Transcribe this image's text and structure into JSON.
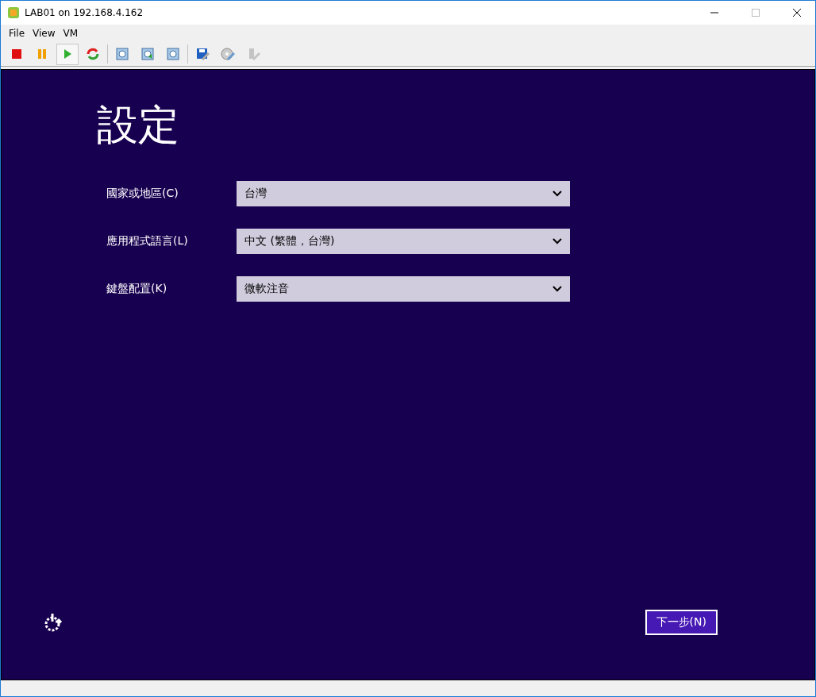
{
  "window": {
    "title": "LAB01 on 192.168.4.162"
  },
  "menu": [
    "File",
    "View",
    "VM"
  ],
  "toolbar": [
    {
      "kind": "stop",
      "selected": false,
      "disabled": false
    },
    {
      "kind": "pause",
      "selected": false,
      "disabled": false
    },
    {
      "kind": "start",
      "selected": true,
      "disabled": false
    },
    {
      "kind": "reset",
      "selected": false,
      "disabled": false
    },
    {
      "kind": "snapshot",
      "selected": false,
      "disabled": false
    },
    {
      "kind": "revert",
      "selected": false,
      "disabled": false
    },
    {
      "kind": "manage",
      "selected": false,
      "disabled": false
    },
    {
      "kind": "floppy",
      "selected": false,
      "disabled": false
    },
    {
      "kind": "cd",
      "selected": false,
      "disabled": false
    },
    {
      "kind": "usb",
      "selected": false,
      "disabled": true
    }
  ],
  "setup": {
    "heading": "設定",
    "fields": [
      {
        "label": "國家或地區(C)",
        "value": "台灣"
      },
      {
        "label": "應用程式語言(L)",
        "value": "中文 (繁體，台灣)"
      },
      {
        "label": "鍵盤配置(K)",
        "value": "微軟注音"
      }
    ],
    "next_button": "下一步(N)"
  }
}
